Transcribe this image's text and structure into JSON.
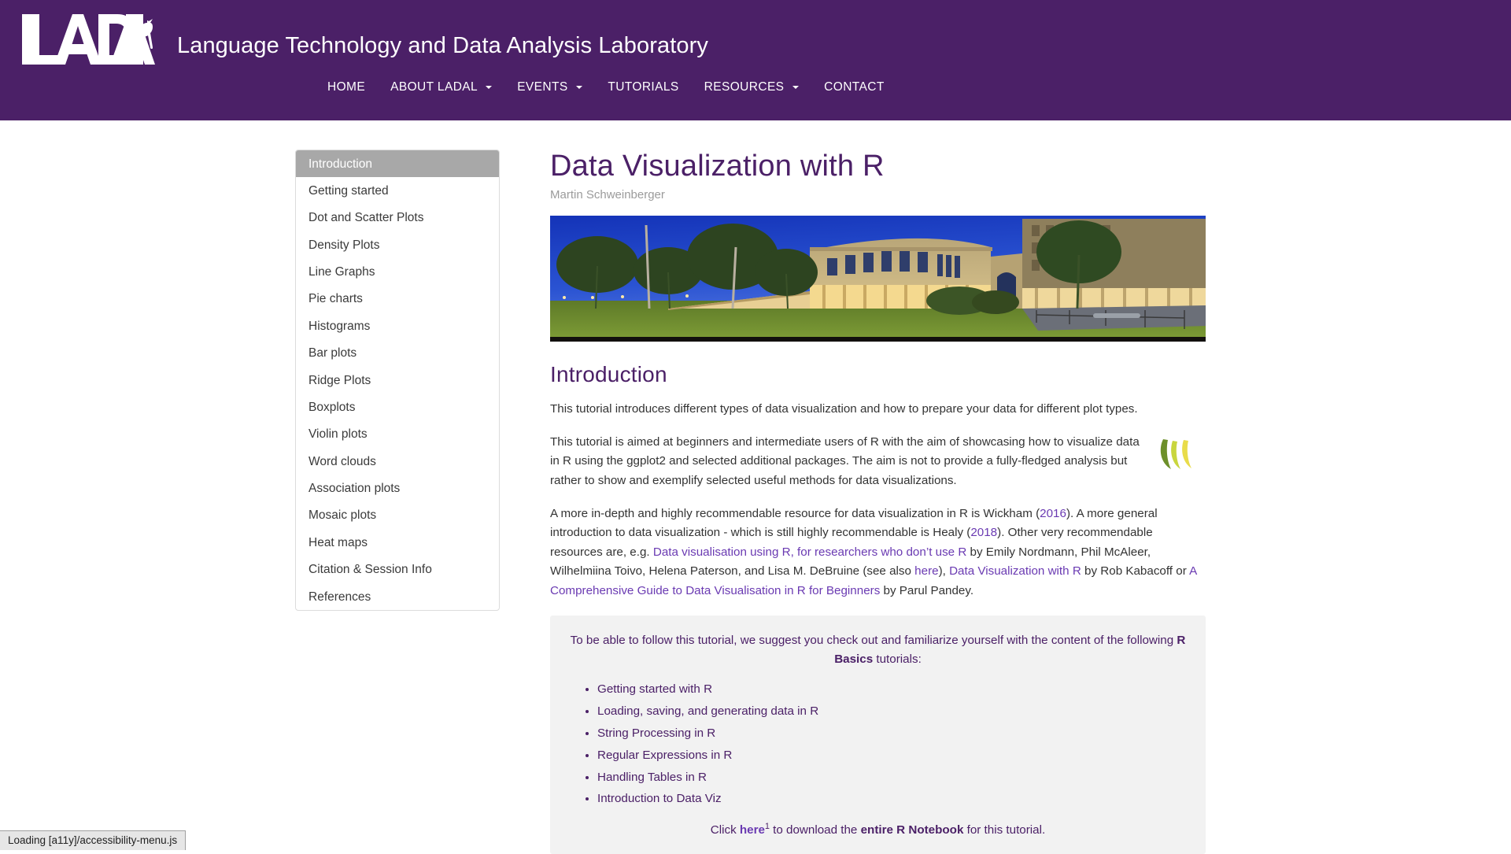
{
  "header": {
    "logo_text": "LADAL",
    "logo_icon": "cassowary-bird-icon",
    "brand_title": "Language Technology and Data Analysis Laboratory",
    "brand_color": "#4b2067",
    "nav": [
      {
        "label": "HOME",
        "dropdown": false
      },
      {
        "label": "ABOUT LADAL",
        "dropdown": true
      },
      {
        "label": "EVENTS",
        "dropdown": true
      },
      {
        "label": "TUTORIALS",
        "dropdown": false
      },
      {
        "label": "RESOURCES",
        "dropdown": true
      },
      {
        "label": "CONTACT",
        "dropdown": false
      }
    ]
  },
  "sidebar": {
    "items": [
      {
        "label": "Introduction",
        "active": true
      },
      {
        "label": "Getting started",
        "active": false
      },
      {
        "label": "Dot and Scatter Plots",
        "active": false
      },
      {
        "label": "Density Plots",
        "active": false
      },
      {
        "label": "Line Graphs",
        "active": false
      },
      {
        "label": "Pie charts",
        "active": false
      },
      {
        "label": "Histograms",
        "active": false
      },
      {
        "label": "Bar plots",
        "active": false
      },
      {
        "label": "Ridge Plots",
        "active": false
      },
      {
        "label": "Boxplots",
        "active": false
      },
      {
        "label": "Violin plots",
        "active": false
      },
      {
        "label": "Word clouds",
        "active": false
      },
      {
        "label": "Association plots",
        "active": false
      },
      {
        "label": "Mosaic plots",
        "active": false
      },
      {
        "label": "Heat maps",
        "active": false
      },
      {
        "label": "Citation & Session Info",
        "active": false
      },
      {
        "label": "References",
        "active": false
      }
    ]
  },
  "main": {
    "title": "Data Visualization with R",
    "author": "Martin Schweinberger",
    "banner_alt": "University sandstone building panorama at dusk",
    "section_heading": "Introduction",
    "para1": "This tutorial introduces different types of data visualization and how to prepare your data for different plot types.",
    "para2": "This tutorial is aimed at beginners and intermediate users of R with the aim of showcasing how to visualize data in R using the ggplot2 and selected additional packages. The aim is not to provide a fully-fledged analysis but rather to show and exemplify selected useful methods for data visualizations.",
    "para3": {
      "t1": "A more in-depth and highly recommendable resource for data visualization in R is Wickham (",
      "l1": "2016",
      "t2": "). A more general introduction to data visualization - which is still highly recommendable is Healy (",
      "l2": "2018",
      "t3": "). Other very recommendable resources are, e.g. ",
      "l3": "Data visualisation using R, for researchers who don’t use R",
      "t4": " by Emily Nordmann, Phil McAleer, Wilhelmiina Toivo, Helena Paterson, and Lisa M. DeBruine (see also ",
      "l4": "here",
      "t5": "), ",
      "l5": "Data Visualization with R",
      "t6": " by Rob Kabacoff or ",
      "l6": "A Comprehensive Guide to Data Visualisation in R for Beginners",
      "t7": " by Parul Pandey."
    },
    "notebox": {
      "intro_a": "To be able to follow this tutorial, we suggest you check out and familiarize yourself with the content of the following ",
      "intro_b": "R Basics",
      "intro_c": " tutorials:",
      "list": [
        "Getting started with R",
        "Loading, saving, and generating data in R",
        "String Processing in R",
        "Regular Expressions in R",
        "Handling Tables in R",
        "Introduction to Data Viz"
      ],
      "download_a": "Click ",
      "download_link": "here",
      "download_sup": "1",
      "download_b": " to download the ",
      "download_bold": "entire R Notebook",
      "download_c": " for this tutorial."
    }
  },
  "statusbar": {
    "text": "Loading [a11y]/accessibility-menu.js"
  }
}
